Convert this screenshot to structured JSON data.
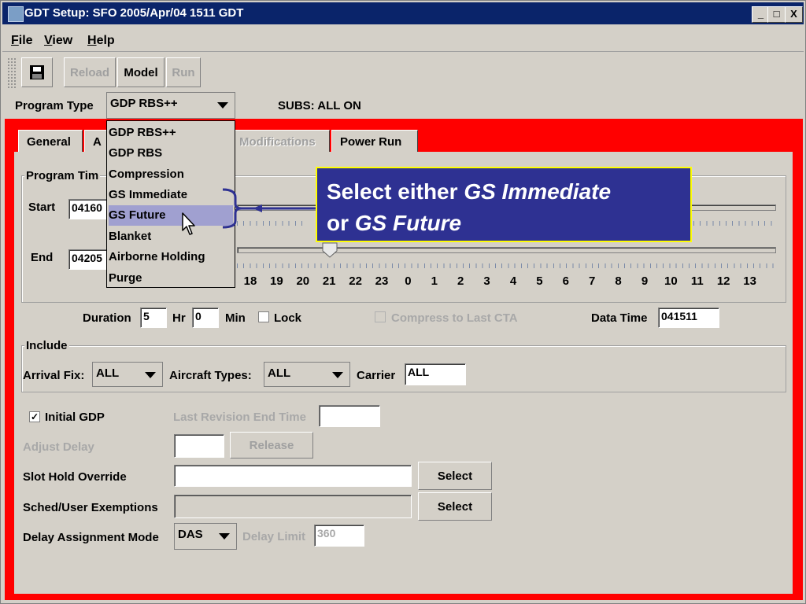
{
  "window": {
    "title": "GDT Setup: SFO 2005/Apr/04 1511 GDT",
    "controls": [
      "_",
      "□",
      "X"
    ]
  },
  "menu": [
    "File",
    "View",
    "Help"
  ],
  "toolbar": {
    "reload": "Reload",
    "model": "Model",
    "run": "Run"
  },
  "program_type": {
    "label": "Program Type",
    "value": "GDP RBS++",
    "subs": "SUBS:  ALL ON"
  },
  "dropdown_options": [
    "GDP RBS++",
    "GDP RBS",
    "Compression",
    "GS Immediate",
    "GS Future",
    "Blanket",
    "Airborne Holding",
    "Purge"
  ],
  "dropdown_highlighted": "GS Future",
  "tabs": [
    "General",
    "A",
    "Modifications",
    "Power Run"
  ],
  "program_time": {
    "title": "Program Tim",
    "start_label": "Start",
    "start_value": "04160",
    "end_label": "End",
    "end_value": "04205",
    "hours": [
      "18",
      "19",
      "20",
      "21",
      "22",
      "23",
      "0",
      "1",
      "2",
      "3",
      "4",
      "5",
      "6",
      "7",
      "8",
      "9",
      "10",
      "11",
      "12",
      "13"
    ]
  },
  "duration": {
    "label": "Duration",
    "hr_value": "5",
    "hr_label": "Hr",
    "min_value": "0",
    "min_label": "Min",
    "lock_label": "Lock",
    "compress_label": "Compress to Last CTA",
    "data_time_label": "Data Time",
    "data_time_value": "041511"
  },
  "include": {
    "title": "Include",
    "arrival_fix_label": "Arrival Fix:",
    "arrival_fix_value": "ALL",
    "aircraft_label": "Aircraft Types:",
    "aircraft_value": "ALL",
    "carrier_label": "Carrier",
    "carrier_value": "ALL"
  },
  "gdp": {
    "initial_gdp": "Initial GDP",
    "initial_gdp_check": "✓",
    "last_revision": "Last Revision End Time",
    "adjust_delay": "Adjust Delay",
    "release": "Release",
    "slot_hold": "Slot Hold Override",
    "sched_user": "Sched/User Exemptions",
    "select": "Select",
    "delay_mode_label": "Delay Assignment Mode",
    "delay_mode_value": "DAS",
    "delay_limit_label": "Delay Limit",
    "delay_limit_value": "360"
  },
  "callout": {
    "line1_prefix": "Select either ",
    "line1_em": "GS Immediate",
    "line2_prefix": "or ",
    "line2_em": "GS Future"
  },
  "colors": {
    "title_bar": "#0a246a",
    "frame_highlight": "#ff0000",
    "callout_bg": "#2e3192",
    "callout_border": "#ffff00",
    "bracket": "#2e3192"
  }
}
